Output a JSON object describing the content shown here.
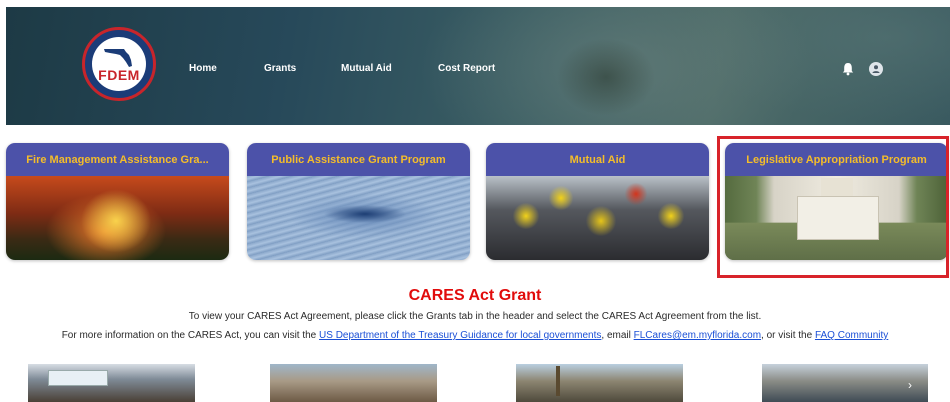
{
  "header": {
    "logo_text": "FDEM",
    "nav": [
      "Home",
      "Grants",
      "Mutual Aid",
      "Cost Report"
    ],
    "icons": [
      "bell-icon",
      "user-avatar-icon"
    ]
  },
  "tiles": [
    {
      "title": "Fire Management Assistance Gra...",
      "image": "wildfire-photo"
    },
    {
      "title": "Public Assistance Grant Program",
      "image": "hurricane-ocean-photo"
    },
    {
      "title": "Mutual Aid",
      "image": "firefighters-photo"
    },
    {
      "title": "Legislative Appropriation Program",
      "image": "capitol-building-photo"
    }
  ],
  "cares": {
    "title": "CARES Act Grant",
    "line1": "To view your CARES Act Agreement, please click the Grants tab in the header and select the CARES Act Agreement from the list.",
    "line2_prefix": "For more information on the CARES Act, you can visit the ",
    "link_treasury": "US Department of the Treasury Guidance for local governments",
    "line2_mid1": ", email ",
    "link_email": "FLCares@em.myflorida.com",
    "line2_mid2": ", or visit the ",
    "link_faq": "FAQ Community"
  },
  "colors": {
    "tile_header": "#4c52a9",
    "tile_title": "#f4bd2a",
    "highlight": "#d8232a",
    "cares_title": "#e10c0c",
    "link": "#1a4fd6"
  }
}
